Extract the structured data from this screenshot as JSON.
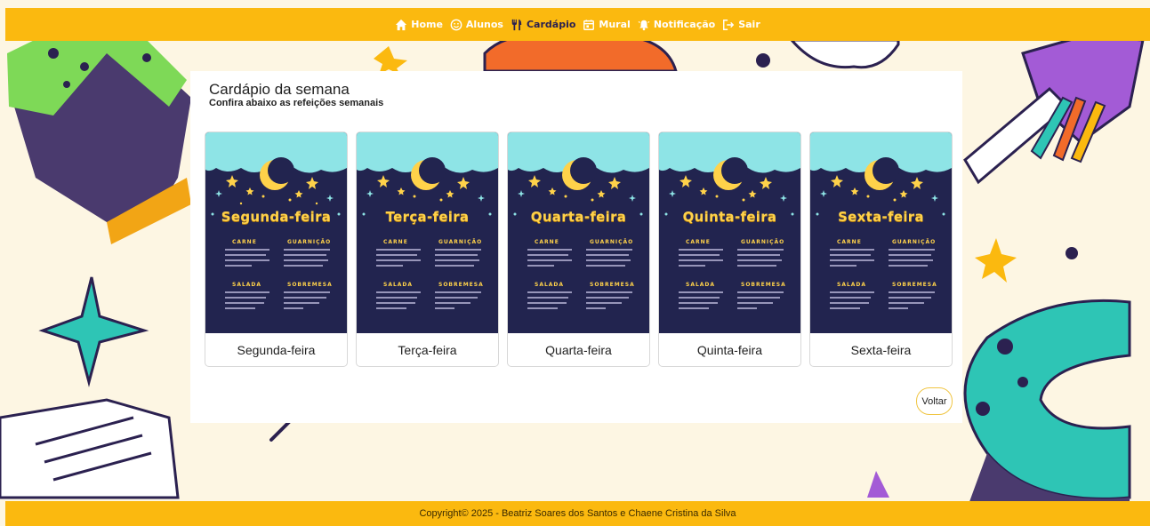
{
  "nav": {
    "items": [
      {
        "label": "Home",
        "icon": "home-icon"
      },
      {
        "label": "Alunos",
        "icon": "smile-icon"
      },
      {
        "label": "Cardápio",
        "icon": "cutlery-icon"
      },
      {
        "label": "Mural",
        "icon": "calendar-icon"
      },
      {
        "label": "Notificação",
        "icon": "bell-icon"
      },
      {
        "label": "Sair",
        "icon": "logout-icon"
      }
    ],
    "active": "Cardápio"
  },
  "page": {
    "title": "Cardápio da semana",
    "subtitle": "Confira abaixo as refeições semanais"
  },
  "poster_sections": {
    "carne": "CARNE",
    "guarnicao": "GUARNIÇÃO",
    "salada": "SALADA",
    "sobremesa": "SOBREMESA"
  },
  "cards": [
    {
      "poster_title": "Segunda-feira",
      "label": "Segunda-feira"
    },
    {
      "poster_title": "Terça-feira",
      "label": "Terça-feira"
    },
    {
      "poster_title": "Quarta-feira",
      "label": "Quarta-feira"
    },
    {
      "poster_title": "Quinta-feira",
      "label": "Quinta-feira"
    },
    {
      "poster_title": "Sexta-feira",
      "label": "Sexta-feira"
    }
  ],
  "back_button": "Voltar",
  "footer": "Copyright© 2025 - Beatriz Soares dos Santos e Chaene Cristina da Silva",
  "colors": {
    "accent": "#fbb90f",
    "background": "#fdf6e3",
    "poster_bg": "#22244f",
    "poster_title": "#ffd24a"
  }
}
